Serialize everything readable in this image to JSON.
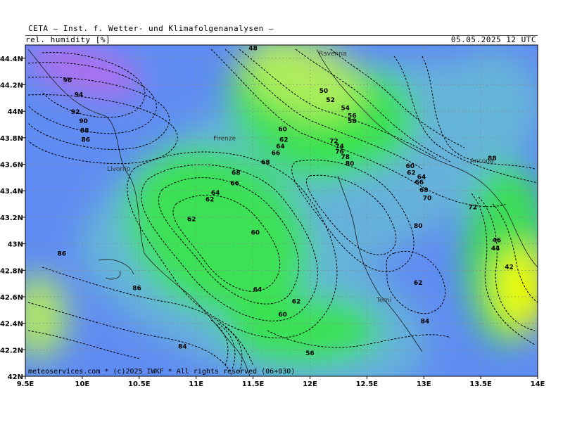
{
  "header": {
    "title": "CETA — Inst. f. Wetter- und Klimafolgenanalysen —",
    "variable": "rel. humidity [%]",
    "datetime": "05.05.2025 12 UTC"
  },
  "footer": "meteoservices.com * (c)2025 IWKF * All rights reserved (06+030)",
  "axes": {
    "x_ticks": [
      "9.5E",
      "10E",
      "10.5E",
      "11E",
      "11.5E",
      "12E",
      "12.5E",
      "13E",
      "13.5E",
      "14E"
    ],
    "y_ticks": [
      "44.4N",
      "44.2N",
      "44N",
      "43.8N",
      "43.6N",
      "43.4N",
      "43.2N",
      "43N",
      "42.8N",
      "42.6N",
      "42.4N",
      "42.2N",
      "42N"
    ],
    "xlim": [
      9.5,
      14.0
    ],
    "ylim": [
      42.0,
      44.5
    ]
  },
  "cities": [
    {
      "name": "Ravenna",
      "lon": 12.2,
      "lat": 44.42
    },
    {
      "name": "Firenze",
      "lon": 11.25,
      "lat": 43.78
    },
    {
      "name": "Livorno",
      "lon": 10.32,
      "lat": 43.55
    },
    {
      "name": "Ancona",
      "lon": 13.51,
      "lat": 43.61
    },
    {
      "name": "Terni",
      "lon": 12.65,
      "lat": 42.56
    }
  ],
  "contour_labels": [
    {
      "v": "48",
      "lon": 11.5,
      "lat": 44.46
    },
    {
      "v": "96",
      "lon": 9.87,
      "lat": 44.22
    },
    {
      "v": "94",
      "lon": 9.97,
      "lat": 44.11
    },
    {
      "v": "92",
      "lon": 9.94,
      "lat": 43.98
    },
    {
      "v": "90",
      "lon": 10.01,
      "lat": 43.91
    },
    {
      "v": "88",
      "lon": 10.02,
      "lat": 43.84
    },
    {
      "v": "86",
      "lon": 10.03,
      "lat": 43.77
    },
    {
      "v": "50",
      "lon": 12.12,
      "lat": 44.14
    },
    {
      "v": "52",
      "lon": 12.18,
      "lat": 44.07
    },
    {
      "v": "54",
      "lon": 12.31,
      "lat": 44.01
    },
    {
      "v": "56",
      "lon": 12.37,
      "lat": 43.95
    },
    {
      "v": "58",
      "lon": 12.37,
      "lat": 43.91
    },
    {
      "v": "60",
      "lon": 11.76,
      "lat": 43.85
    },
    {
      "v": "62",
      "lon": 11.77,
      "lat": 43.77
    },
    {
      "v": "64",
      "lon": 11.74,
      "lat": 43.72
    },
    {
      "v": "66",
      "lon": 11.7,
      "lat": 43.67
    },
    {
      "v": "68",
      "lon": 11.61,
      "lat": 43.6
    },
    {
      "v": "72",
      "lon": 12.21,
      "lat": 43.76
    },
    {
      "v": "74",
      "lon": 12.26,
      "lat": 43.72
    },
    {
      "v": "76",
      "lon": 12.26,
      "lat": 43.68
    },
    {
      "v": "78",
      "lon": 12.31,
      "lat": 43.64
    },
    {
      "v": "80",
      "lon": 12.35,
      "lat": 43.59
    },
    {
      "v": "68",
      "lon": 11.35,
      "lat": 43.52
    },
    {
      "v": "66",
      "lon": 11.34,
      "lat": 43.44
    },
    {
      "v": "64",
      "lon": 11.17,
      "lat": 43.37
    },
    {
      "v": "62",
      "lon": 11.12,
      "lat": 43.32
    },
    {
      "v": "60",
      "lon": 12.88,
      "lat": 43.57
    },
    {
      "v": "62",
      "lon": 12.89,
      "lat": 43.52
    },
    {
      "v": "64",
      "lon": 12.98,
      "lat": 43.49
    },
    {
      "v": "66",
      "lon": 12.96,
      "lat": 43.45
    },
    {
      "v": "68",
      "lon": 13.0,
      "lat": 43.39
    },
    {
      "v": "70",
      "lon": 13.03,
      "lat": 43.33
    },
    {
      "v": "72",
      "lon": 13.43,
      "lat": 43.26
    },
    {
      "v": "62",
      "lon": 10.96,
      "lat": 43.17
    },
    {
      "v": "60",
      "lon": 11.52,
      "lat": 43.07
    },
    {
      "v": "80",
      "lon": 12.95,
      "lat": 43.12
    },
    {
      "v": "86",
      "lon": 9.82,
      "lat": 42.91
    },
    {
      "v": "46",
      "lon": 13.64,
      "lat": 43.01
    },
    {
      "v": "44",
      "lon": 13.63,
      "lat": 42.95
    },
    {
      "v": "42",
      "lon": 13.75,
      "lat": 42.81
    },
    {
      "v": "64",
      "lon": 11.54,
      "lat": 42.64
    },
    {
      "v": "86",
      "lon": 10.48,
      "lat": 42.65
    },
    {
      "v": "62",
      "lon": 11.88,
      "lat": 42.55
    },
    {
      "v": "60",
      "lon": 11.76,
      "lat": 42.45
    },
    {
      "v": "62",
      "lon": 12.95,
      "lat": 42.69
    },
    {
      "v": "84",
      "lon": 13.01,
      "lat": 42.4
    },
    {
      "v": "84",
      "lon": 10.88,
      "lat": 42.21
    },
    {
      "v": "56",
      "lon": 12.0,
      "lat": 42.16
    },
    {
      "v": "88",
      "lon": 13.6,
      "lat": 43.63
    }
  ],
  "colors": {
    "frame": "#000000",
    "humid_high": "#b76bf0",
    "humid_mid": "#5f8cf2",
    "moist": "#66b6d8",
    "dry_mid": "#37e646",
    "dry_low": "#b8f05a",
    "very_dry": "#ffff00"
  }
}
